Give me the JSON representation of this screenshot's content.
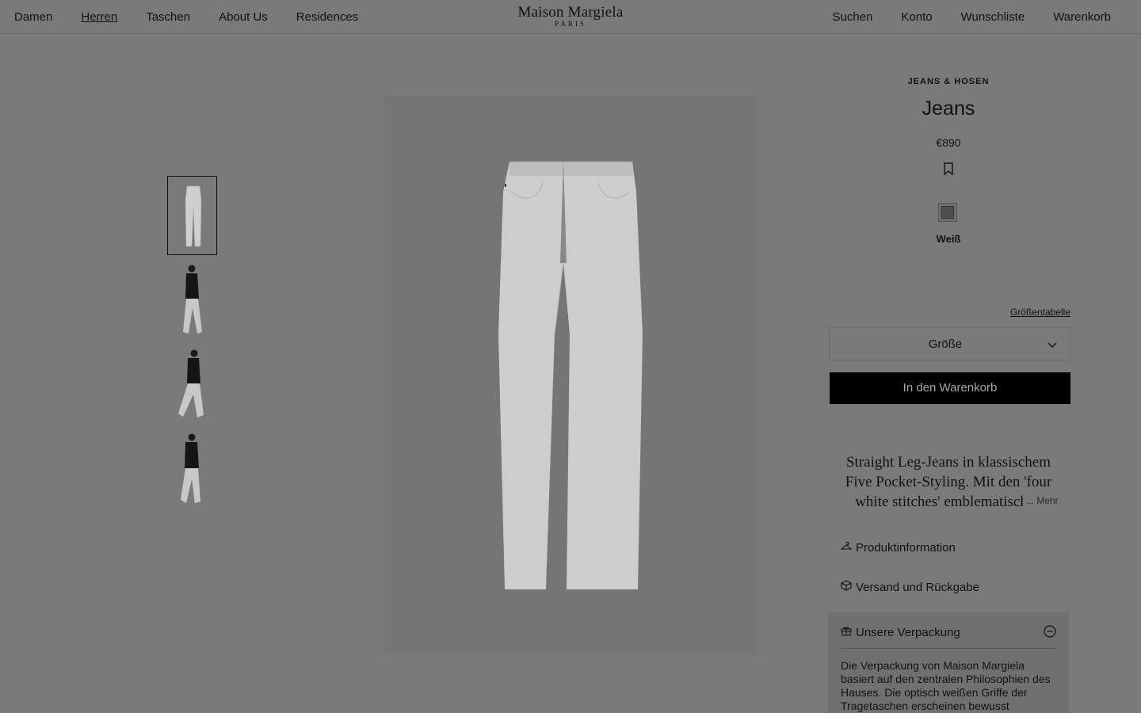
{
  "header": {
    "nav_left": [
      "Damen",
      "Herren",
      "Taschen",
      "About Us",
      "Residences"
    ],
    "active_nav": "Herren",
    "logo_name": "Maison Margiela",
    "logo_city": "PARIS",
    "nav_right": [
      "Suchen",
      "Konto",
      "Wunschliste",
      "Warenkorb"
    ]
  },
  "gallery": {
    "thumbnail_count": 4,
    "selected_index": 0
  },
  "product": {
    "category": "JEANS & HOSEN",
    "title": "Jeans",
    "price": "€890",
    "color_label": "Weiß",
    "size_chart_link": "Größentabelle",
    "size_select_label": "Größe",
    "add_to_cart": "In den Warenkorb",
    "description": "Straight Leg-Jeans in klassischem Five Pocket-Styling. Mit den 'four white stitches' emblematischen",
    "more_link": "... Mehr"
  },
  "accordion": {
    "product_info": "Produktinformation",
    "shipping": "Versand und Rückgabe",
    "packaging": "Unsere Verpackung",
    "packaging_text": "Die Verpackung von Maison Margiela basiert auf den zentralen Philosophien des Hauses. Die optisch weißen Griffe der Tragetaschen erscheinen bewusst"
  },
  "icons": {
    "bookmark": "bookmark-icon",
    "chevron": "chevron-down-icon",
    "hanger": "hanger-icon",
    "box": "box-icon",
    "gift": "gift-icon",
    "collapse": "minus-circle-icon"
  }
}
